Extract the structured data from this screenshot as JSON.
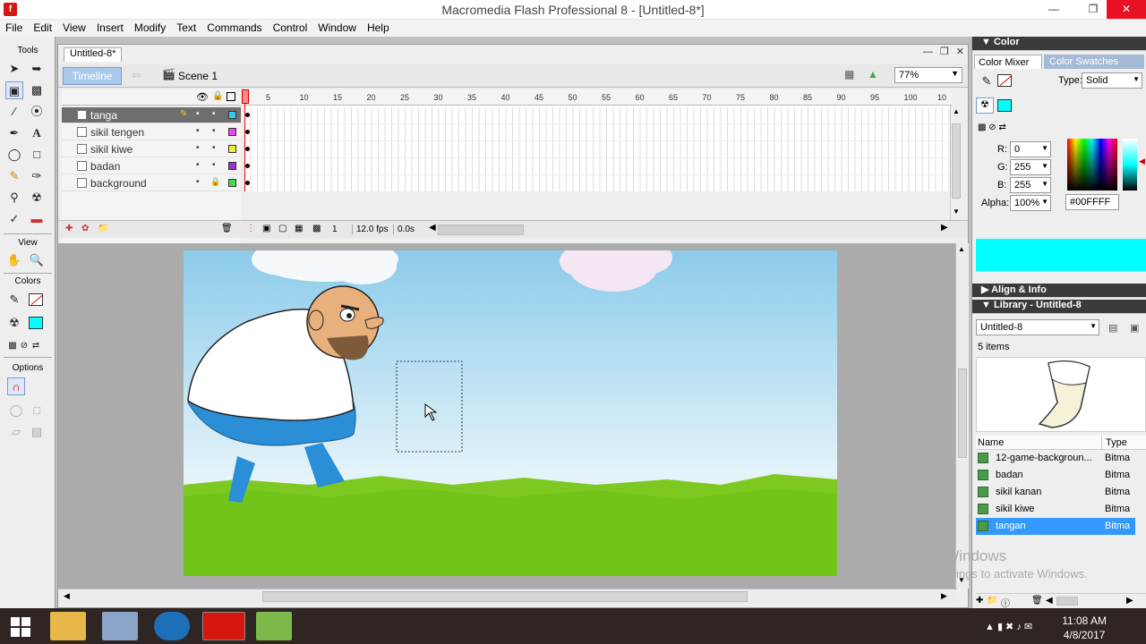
{
  "window": {
    "title": "Macromedia Flash Professional 8 - [Untitled-8*]",
    "app_icon": "f"
  },
  "menu": [
    "File",
    "Edit",
    "View",
    "Insert",
    "Modify",
    "Text",
    "Commands",
    "Control",
    "Window",
    "Help"
  ],
  "tools": {
    "header": "Tools",
    "view_header": "View",
    "colors_header": "Colors",
    "options_header": "Options"
  },
  "document": {
    "tab": "Untitled-8*",
    "timeline_button": "Timeline",
    "scene": "Scene 1",
    "zoom": "77%",
    "layers": [
      {
        "name": "tanga",
        "color": "#33ccee",
        "selected": true
      },
      {
        "name": "sikil tengen",
        "color": "#ee44ee",
        "selected": false
      },
      {
        "name": "sikil kiwe",
        "color": "#eeee33",
        "selected": false
      },
      {
        "name": "badan",
        "color": "#9933cc",
        "selected": false
      },
      {
        "name": "background",
        "color": "#44dd44",
        "selected": false,
        "locked": true
      }
    ],
    "frame_numbers": [
      "5",
      "10",
      "15",
      "20",
      "25",
      "30",
      "35",
      "40",
      "45",
      "50",
      "55",
      "60",
      "65",
      "70",
      "75",
      "80",
      "85",
      "90",
      "95",
      "100",
      "10"
    ],
    "status": {
      "frame": "1",
      "fps": "12.0 fps",
      "time": "0.0s"
    }
  },
  "color_panel": {
    "title": "Color",
    "tab_mixer": "Color Mixer",
    "tab_swatches": "Color Swatches",
    "type_label": "Type:",
    "type_value": "Solid",
    "r_label": "R:",
    "r_value": "0",
    "g_label": "G:",
    "g_value": "255",
    "b_label": "B:",
    "b_value": "255",
    "alpha_label": "Alpha:",
    "alpha_value": "100%",
    "hex": "#00FFFF",
    "preview_color": "#00ffff"
  },
  "align_panel": {
    "title": "Align & Info"
  },
  "library": {
    "title": "Library - Untitled-8",
    "doc": "Untitled-8",
    "count": "5 items",
    "col_name": "Name",
    "col_type": "Type",
    "items": [
      {
        "name": "12-game-backgroun...",
        "type": "Bitma"
      },
      {
        "name": "badan",
        "type": "Bitma"
      },
      {
        "name": "sikil kanan",
        "type": "Bitma"
      },
      {
        "name": "sikil kiwe",
        "type": "Bitma"
      },
      {
        "name": "tangan",
        "type": "Bitma",
        "selected": true
      }
    ]
  },
  "watermark": {
    "line1": "Activate Windows",
    "line2": "Go to PC settings to activate Windows."
  },
  "clock": {
    "time": "11:08 AM",
    "date": "4/8/2017"
  }
}
